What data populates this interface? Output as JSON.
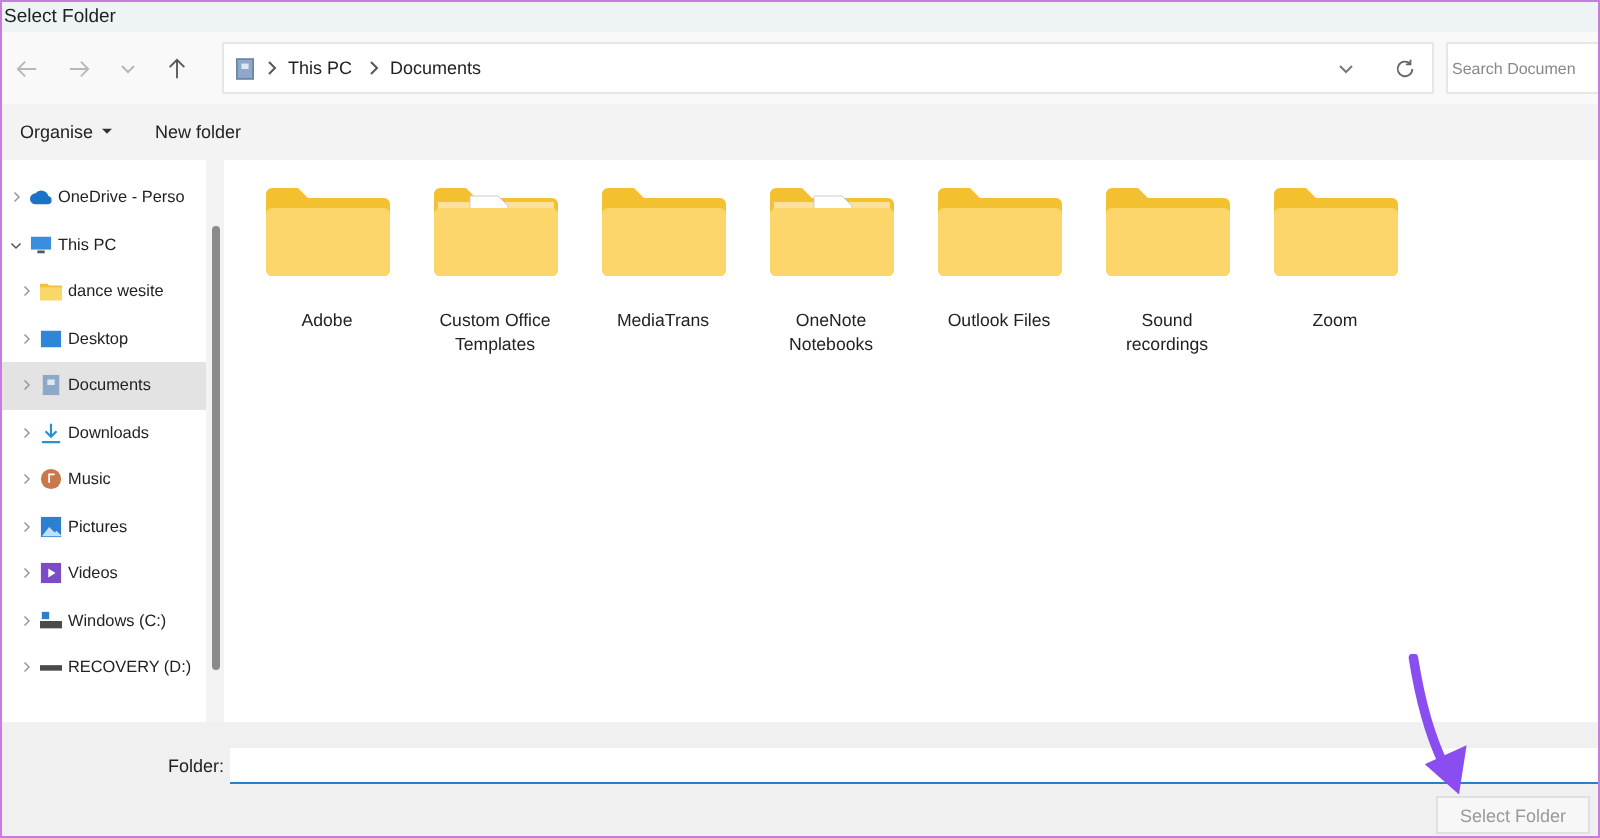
{
  "window": {
    "title": "Select Folder"
  },
  "breadcrumb": [
    "This PC",
    "Documents"
  ],
  "search": {
    "placeholder": "Search Documen"
  },
  "commands": [
    {
      "label": "Organise",
      "dropdown": true
    },
    {
      "label": "New folder",
      "dropdown": false
    }
  ],
  "sidebar": {
    "items": [
      {
        "label": "OneDrive - Perso",
        "kind": "cloud",
        "expanded": false,
        "selected": false
      },
      {
        "label": "This PC",
        "kind": "monitor",
        "expanded": true,
        "selected": false,
        "children": [
          {
            "label": "dance wesite",
            "kind": "folder",
            "expanded": false,
            "selected": false
          },
          {
            "label": "Desktop",
            "kind": "desktop",
            "expanded": false,
            "selected": false
          },
          {
            "label": "Documents",
            "kind": "documents",
            "expanded": false,
            "selected": true
          },
          {
            "label": "Downloads",
            "kind": "download",
            "expanded": false,
            "selected": false
          },
          {
            "label": "Music",
            "kind": "music",
            "expanded": false,
            "selected": false
          },
          {
            "label": "Pictures",
            "kind": "pictures",
            "expanded": false,
            "selected": false
          },
          {
            "label": "Videos",
            "kind": "videos",
            "expanded": false,
            "selected": false
          },
          {
            "label": "Windows (C:)",
            "kind": "windrive",
            "expanded": false,
            "selected": false
          },
          {
            "label": "RECOVERY (D:)",
            "kind": "drive",
            "expanded": false,
            "selected": false
          }
        ]
      }
    ]
  },
  "folders": [
    {
      "name": "Adobe",
      "kind": "plain"
    },
    {
      "name": "Custom Office Templates",
      "kind": "word"
    },
    {
      "name": "MediaTrans",
      "kind": "plain"
    },
    {
      "name": "OneNote Notebooks",
      "kind": "document"
    },
    {
      "name": "Outlook Files",
      "kind": "plain"
    },
    {
      "name": "Sound recordings",
      "kind": "plain"
    },
    {
      "name": "Zoom",
      "kind": "plain"
    }
  ],
  "footer": {
    "folder_label": "Folder:",
    "button": {
      "label": "Select Folder",
      "disabled": true
    }
  }
}
